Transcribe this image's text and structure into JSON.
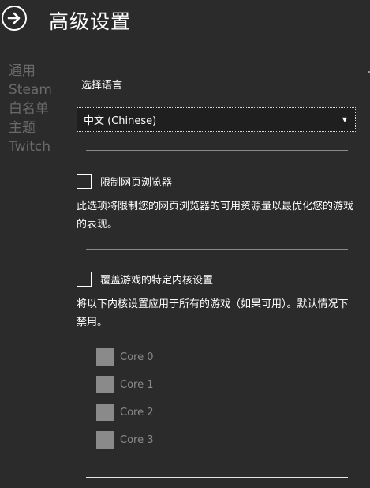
{
  "header": {
    "title": "高级设置",
    "back_icon": "arrow-right-circle-icon"
  },
  "nav": {
    "items": [
      {
        "label": "通用"
      },
      {
        "label": "Steam"
      },
      {
        "label": "白名单"
      },
      {
        "label": "主题"
      },
      {
        "label": "Twitch"
      }
    ]
  },
  "language": {
    "section_label": "选择语言",
    "selected": "中文 (Chinese)",
    "caret": "▼"
  },
  "browser_limit": {
    "label": "限制网页浏览器",
    "checked": false,
    "description": "此选项将限制您的网页浏览器的可用资源量以最优化您的游戏的表现。"
  },
  "core_override": {
    "label": "覆盖游戏的特定内核设置",
    "checked": false,
    "description": "将以下内核设置应用于所有的游戏（如果可用）。默认情况下禁用。",
    "cores": [
      {
        "label": "Core 0",
        "checked": false
      },
      {
        "label": "Core 1",
        "checked": false
      },
      {
        "label": "Core 2",
        "checked": false
      },
      {
        "label": "Core 3",
        "checked": false
      }
    ]
  },
  "colors": {
    "background": "#2b2b2b",
    "nav_text": "#6a6a6a",
    "disabled": "#8a8a8a",
    "text": "#ffffff"
  }
}
